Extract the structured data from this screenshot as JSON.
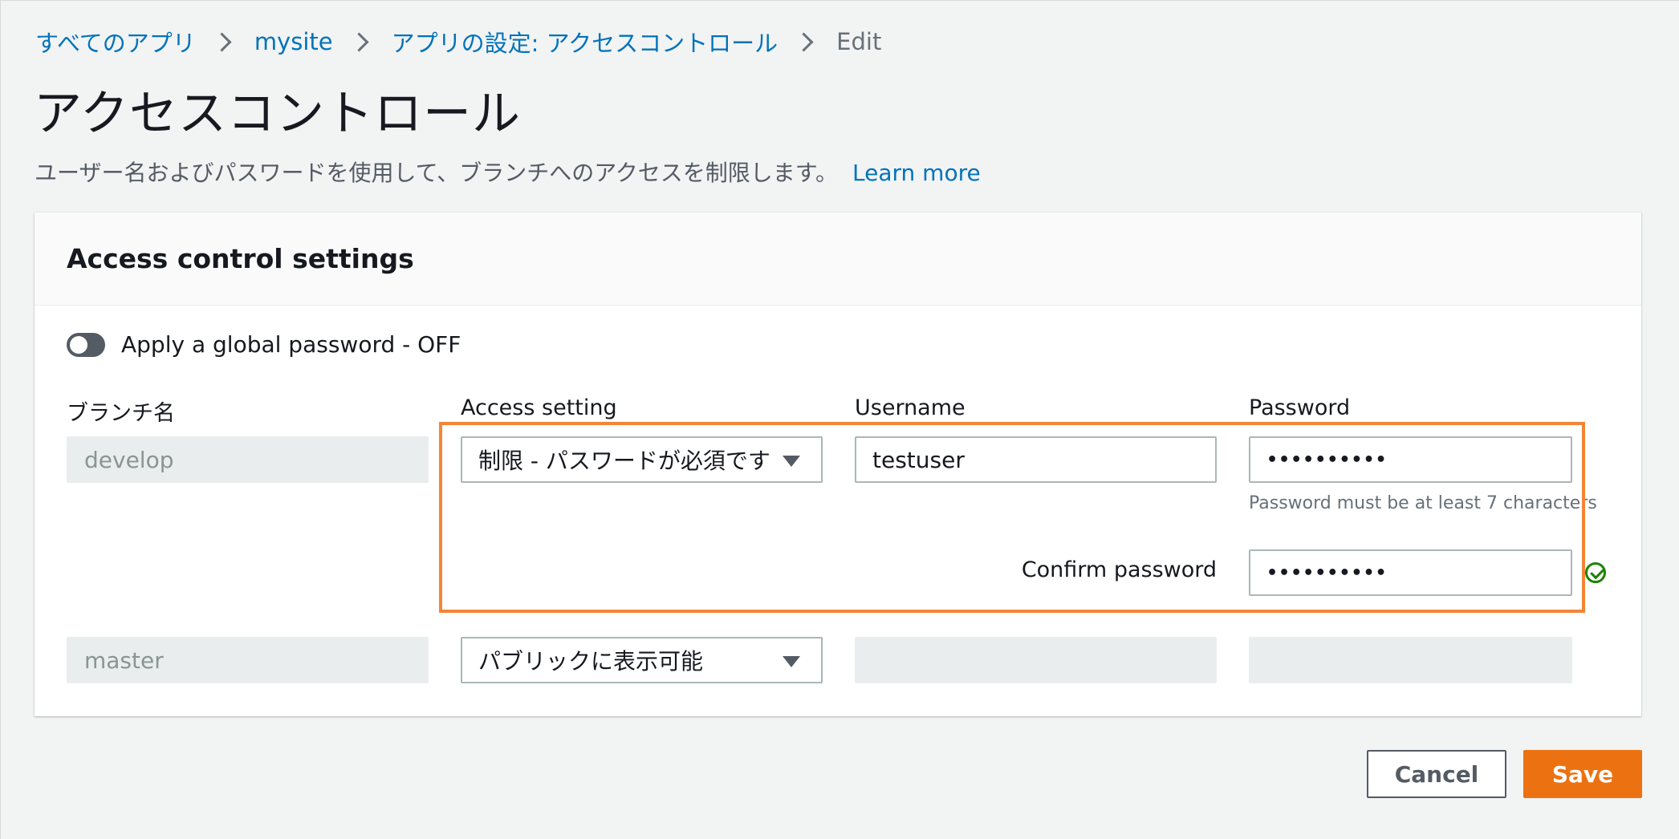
{
  "breadcrumb": {
    "items": [
      "すべてのアプリ",
      "mysite",
      "アプリの設定: アクセスコントロール"
    ],
    "current": "Edit"
  },
  "page": {
    "title": "アクセスコントロール",
    "description": "ユーザー名およびパスワードを使用して、ブランチへのアクセスを制限します。",
    "learn_more": "Learn more"
  },
  "panel": {
    "title": "Access control settings",
    "toggle_label": "Apply a global password - OFF",
    "toggle_on": false,
    "columns": {
      "branch": "ブランチ名",
      "access": "Access setting",
      "username": "Username",
      "password": "Password"
    },
    "rows": [
      {
        "branch": "develop",
        "access": "制限 - パスワードが必須です",
        "username": "testuser",
        "password": "••••••••••",
        "password_hint": "Password must be at least 7 characters",
        "confirm_label": "Confirm password",
        "confirm_password": "••••••••••"
      },
      {
        "branch": "master",
        "access": "パブリックに表示可能",
        "username": "",
        "password": ""
      }
    ]
  },
  "actions": {
    "cancel": "Cancel",
    "save": "Save"
  },
  "colors": {
    "link": "#0073bb",
    "primary": "#ec7211",
    "highlight": "#f58536",
    "success": "#1d8102"
  }
}
